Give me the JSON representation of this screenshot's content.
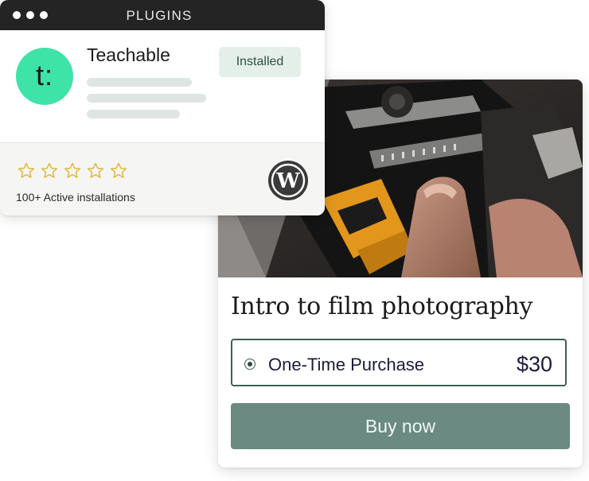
{
  "plugin_window": {
    "title": "PLUGINS",
    "plugin_name": "Teachable",
    "logo_glyph": "t:",
    "status_label": "Installed",
    "rating_stars": 0,
    "rating_max": 5,
    "installations_text": "100+ Active installations",
    "icons": {
      "platform": "wordpress-icon",
      "rating": "star-icon"
    }
  },
  "course_card": {
    "title": "Intro to film photography",
    "option": {
      "label": "One-Time Purchase",
      "price": "$30",
      "selected": true
    },
    "buy_label": "Buy now"
  },
  "colors": {
    "accent_green": "#3ee3a8",
    "button_green": "#6a8a82",
    "title_bar": "#242424",
    "star_gold": "#e0b93a"
  }
}
